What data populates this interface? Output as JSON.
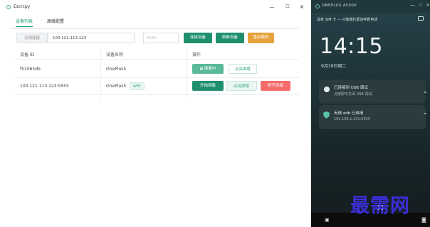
{
  "app": {
    "title": "Escrcpy",
    "window_controls": {
      "minimize": "—",
      "maximize": "☐",
      "close": "×"
    },
    "tabs": [
      {
        "label": "设备列表",
        "active": true
      },
      {
        "label": "高级配置",
        "active": false
      }
    ],
    "toolbar": {
      "mode_label": "无线连接",
      "ip_value": "100.121.113.123",
      "colon": ":",
      "port_placeholder": "5555",
      "connect_label": "连接设备",
      "refresh_label": "刷新设备",
      "restart_label": "重启服务"
    },
    "table": {
      "headers": [
        "设备 ID",
        "设备名称",
        "操作"
      ],
      "rows": [
        {
          "id": "f51065db",
          "name": "OnePlus5",
          "tag": "",
          "actions": {
            "mirror": "镜像中",
            "screen_off": "点亮屏幕"
          }
        },
        {
          "id": "100.121.113.123:5555",
          "name": "OnePlus5",
          "tag": "WIFI",
          "actions": {
            "mirror": "开始镜像",
            "screen_off": "点亮屏幕",
            "disconnect": "断开连接"
          }
        }
      ]
    }
  },
  "phone": {
    "window_title": "ONEPLUS A5000",
    "controls": {
      "minimize": "—",
      "maximize": "☐",
      "close": "×"
    },
    "status_text": "没有 SIM 卡 — 只能拨打紧急呼救电话",
    "clock": "14:15",
    "date": "9月19日周二",
    "notifications": [
      {
        "title": "已连接到 USB 调试",
        "subtitle": "点按即可关闭 USB 调试"
      },
      {
        "title": "无线 adb 已启用",
        "subtitle": "192.168.1.151:5555"
      }
    ],
    "watermark": "最需网"
  },
  "colors": {
    "accent": "#1f8f6e",
    "warning": "#e6a23c",
    "danger": "#f56c6c",
    "phone_bg": "#1d3136"
  }
}
